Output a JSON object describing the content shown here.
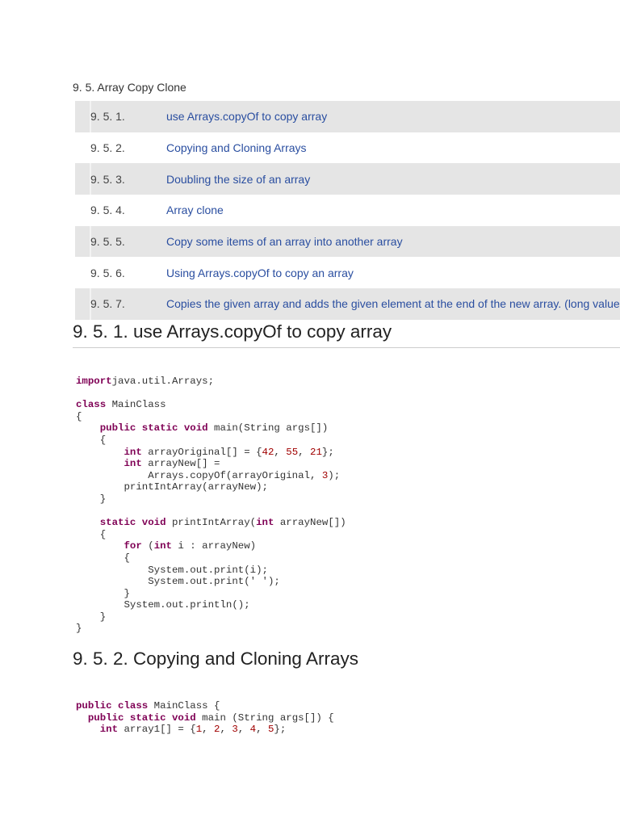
{
  "section_title": "9. 5. Array Copy Clone",
  "toc": [
    {
      "num": "9. 5. 1.",
      "label": "use Arrays.copyOf to copy array"
    },
    {
      "num": "9. 5. 2.",
      "label": "Copying and Cloning Arrays"
    },
    {
      "num": "9. 5. 3.",
      "label": "Doubling the size of an array"
    },
    {
      "num": "9. 5. 4.",
      "label": "Array clone"
    },
    {
      "num": "9. 5. 5.",
      "label": "Copy some items of an array into another array"
    },
    {
      "num": "9. 5. 6.",
      "label": "Using Arrays.copyOf to copy an array"
    },
    {
      "num": "9. 5. 7.",
      "label": "Copies the given array and adds the given element at the end of the new array. (long value type)"
    }
  ],
  "sections": [
    {
      "heading": "9. 5. 1. use Arrays.copyOf to copy array",
      "code": [
        [
          [
            "kw",
            "import"
          ],
          [
            "",
            "java.util.Arrays;"
          ]
        ],
        [],
        [
          [
            "kw",
            "class"
          ],
          [
            "",
            " MainClass"
          ]
        ],
        [
          [
            "",
            "{"
          ]
        ],
        [
          [
            "",
            "    "
          ],
          [
            "kw",
            "public static void"
          ],
          [
            "",
            " main(String args[])"
          ]
        ],
        [
          [
            "",
            "    {"
          ]
        ],
        [
          [
            "",
            "        "
          ],
          [
            "kw",
            "int"
          ],
          [
            "",
            " arrayOriginal[] = {"
          ],
          [
            "num",
            "42"
          ],
          [
            "",
            ", "
          ],
          [
            "num",
            "55"
          ],
          [
            "",
            ", "
          ],
          [
            "num",
            "21"
          ],
          [
            "",
            "};"
          ]
        ],
        [
          [
            "",
            "        "
          ],
          [
            "kw",
            "int"
          ],
          [
            "",
            " arrayNew[] ="
          ]
        ],
        [
          [
            "",
            "            Arrays.copyOf(arrayOriginal, "
          ],
          [
            "num",
            "3"
          ],
          [
            "",
            ");"
          ]
        ],
        [
          [
            "",
            "        printIntArray(arrayNew);"
          ]
        ],
        [
          [
            "",
            "    }"
          ]
        ],
        [],
        [
          [
            "",
            "    "
          ],
          [
            "kw",
            "static void"
          ],
          [
            "",
            " printIntArray("
          ],
          [
            "kw",
            "int"
          ],
          [
            "",
            " arrayNew[])"
          ]
        ],
        [
          [
            "",
            "    {"
          ]
        ],
        [
          [
            "",
            "        "
          ],
          [
            "kw",
            "for"
          ],
          [
            "",
            " ("
          ],
          [
            "kw",
            "int"
          ],
          [
            "",
            " i : arrayNew)"
          ]
        ],
        [
          [
            "",
            "        {"
          ]
        ],
        [
          [
            "",
            "            System.out.print(i);"
          ]
        ],
        [
          [
            "",
            "            System.out.print(' ');"
          ]
        ],
        [
          [
            "",
            "        }"
          ]
        ],
        [
          [
            "",
            "        System.out.println();"
          ]
        ],
        [
          [
            "",
            "    }"
          ]
        ],
        [
          [
            "",
            "}"
          ]
        ]
      ]
    },
    {
      "heading": "9. 5. 2. Copying and Cloning Arrays",
      "code": [
        [
          [
            "kw",
            "public class"
          ],
          [
            "",
            " MainClass {"
          ]
        ],
        [
          [
            "",
            "  "
          ],
          [
            "kw",
            "public static void"
          ],
          [
            "",
            " main (String args[]) {"
          ]
        ],
        [
          [
            "",
            "    "
          ],
          [
            "kw",
            "int"
          ],
          [
            "",
            " array1[] = {"
          ],
          [
            "num",
            "1"
          ],
          [
            "",
            ", "
          ],
          [
            "num",
            "2"
          ],
          [
            "",
            ", "
          ],
          [
            "num",
            "3"
          ],
          [
            "",
            ", "
          ],
          [
            "num",
            "4"
          ],
          [
            "",
            ", "
          ],
          [
            "num",
            "5"
          ],
          [
            "",
            "};"
          ]
        ]
      ]
    }
  ]
}
